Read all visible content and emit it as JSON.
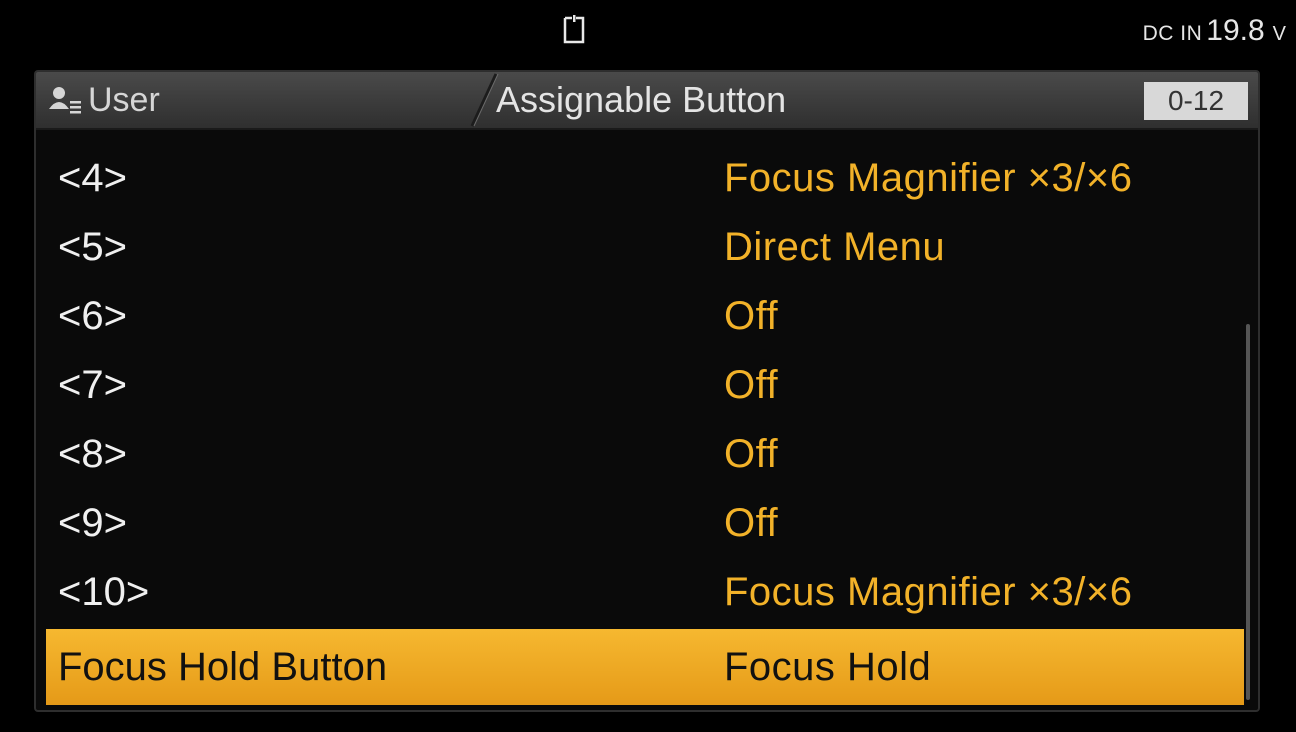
{
  "status_bar": {
    "media_icon": "media-card-icon",
    "power_label": "DC IN",
    "power_value": "19.8",
    "power_unit": "V"
  },
  "menu": {
    "category": "User",
    "category_icon": "user-icon",
    "title": "Assignable Button",
    "page_code": "0-12",
    "items": [
      {
        "label": "<4>",
        "value": "Focus Magnifier ×3/×6"
      },
      {
        "label": "<5>",
        "value": "Direct Menu"
      },
      {
        "label": "<6>",
        "value": "Off"
      },
      {
        "label": "<7>",
        "value": "Off"
      },
      {
        "label": "<8>",
        "value": "Off"
      },
      {
        "label": "<9>",
        "value": "Off"
      },
      {
        "label": "<10>",
        "value": "Focus Magnifier ×3/×6"
      },
      {
        "label": "Focus Hold Button",
        "value": "Focus Hold"
      }
    ],
    "selected_index": 7
  },
  "colors": {
    "value_text": "#f2b229",
    "highlight": "#f0aa28",
    "header_bg": "#3c3c3c"
  }
}
